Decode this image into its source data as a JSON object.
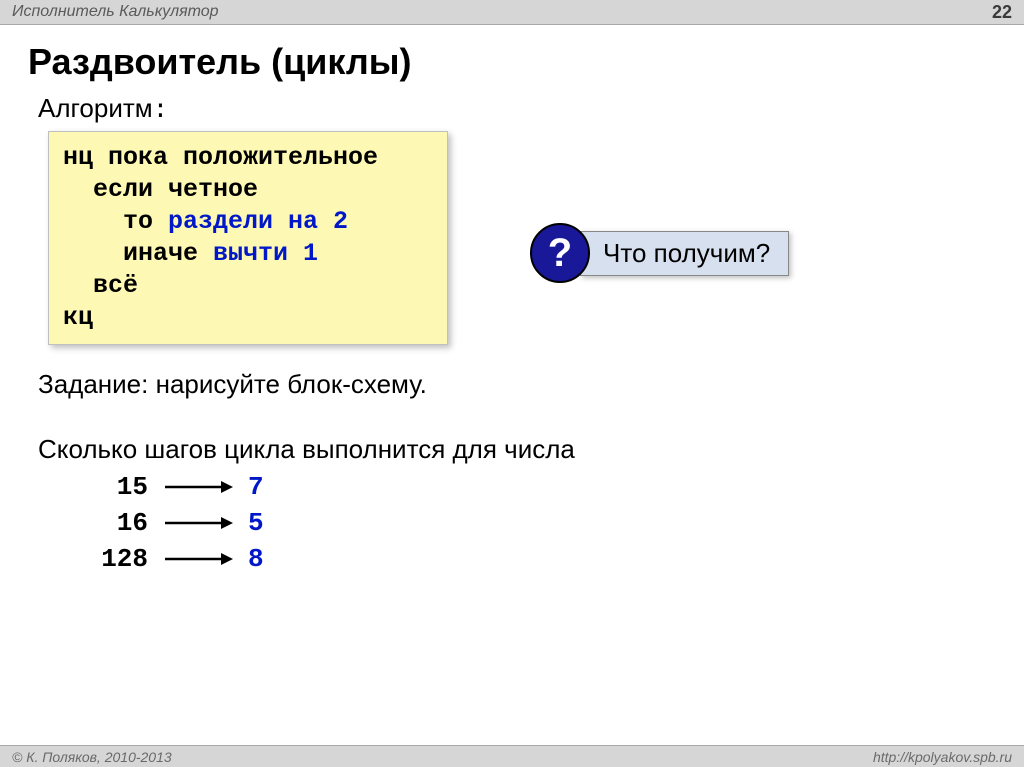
{
  "header": {
    "left": "Исполнитель Калькулятор",
    "page": "22"
  },
  "title": "Раздвоитель (циклы)",
  "algorithm_label_text": "Алгоритм",
  "algorithm_label_colon": ":",
  "code": {
    "l1": "нц пока положительное",
    "l2": "  если четное",
    "l3a": "    то ",
    "l3b": "раздели на 2",
    "l4a": "    иначе ",
    "l4b": "вычти 1",
    "l5": "  всё",
    "l6": "кц"
  },
  "callout": {
    "mark": "?",
    "text": "Что получим?"
  },
  "task": "Задание: нарисуйте блок-схему.",
  "question2": "Сколько шагов цикла выполнится для числа",
  "steps": [
    {
      "n": "15",
      "ans": "7"
    },
    {
      "n": "16",
      "ans": "5"
    },
    {
      "n": "128",
      "ans": "8"
    }
  ],
  "footer": {
    "left": "© К. Поляков, 2010-2013",
    "right": "http://kpolyakov.spb.ru"
  }
}
